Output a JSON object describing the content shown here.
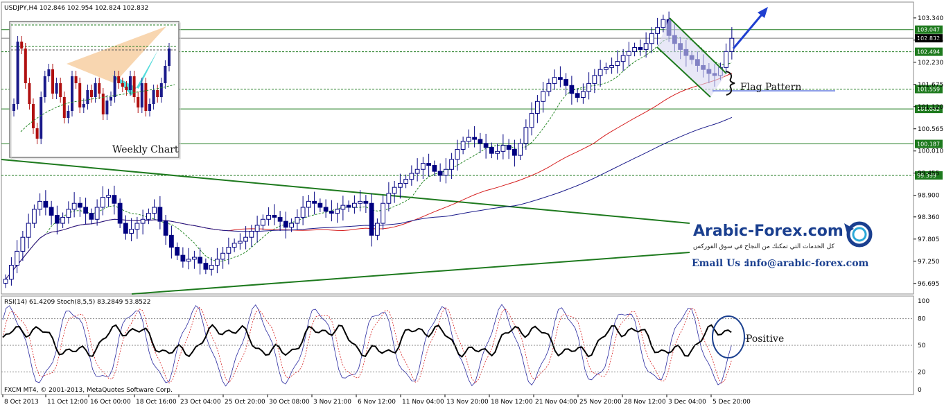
{
  "chart_data": {
    "type": "candlestick",
    "symbol_line": "USDJPY,H4  102.846 102.954 102.824 102.832",
    "y_ticks": [
      "103.340",
      "102.785",
      "102.230",
      "101.675",
      "101.120",
      "100.565",
      "100.010",
      "99.455",
      "98.900",
      "98.360",
      "97.805",
      "97.250",
      "96.695"
    ],
    "y_range": [
      96.5,
      103.65
    ],
    "x_ticks": [
      "8 Oct 2013",
      "11 Oct 12:00",
      "16 Oct 00:00",
      "18 Oct 16:00",
      "23 Oct 04:00",
      "25 Oct 20:00",
      "30 Oct 08:00",
      "3 Nov 21:00",
      "6 Nov 12:00",
      "11 Nov 04:00",
      "13 Nov 20:00",
      "18 Nov 12:00",
      "21 Nov 04:00",
      "25 Nov 20:00",
      "28 Nov 12:00",
      "3 Dec 04:00",
      "5 Dec 20:00"
    ],
    "levels": [
      {
        "value": "103.047",
        "style": "solid",
        "boxed": true
      },
      {
        "value": "102.832",
        "style": "solid",
        "boxed": true,
        "current": true
      },
      {
        "value": "102.494",
        "style": "dashed",
        "boxed": true
      },
      {
        "value": "101.559",
        "style": "dashed",
        "boxed": true
      },
      {
        "value": "101.062",
        "style": "solid",
        "boxed": true
      },
      {
        "value": "100.187",
        "style": "solid",
        "boxed": true
      },
      {
        "value": "99.399",
        "style": "dashed",
        "boxed": true
      }
    ],
    "closes": [
      96.8,
      97.15,
      97.5,
      97.85,
      98.2,
      98.55,
      98.75,
      98.6,
      98.4,
      98.2,
      98.35,
      98.55,
      98.7,
      98.6,
      98.45,
      98.3,
      98.6,
      98.85,
      98.9,
      98.7,
      98.2,
      97.95,
      98.05,
      98.2,
      98.3,
      98.45,
      98.6,
      98.25,
      97.9,
      97.6,
      97.4,
      97.25,
      97.3,
      97.35,
      97.2,
      97.05,
      97.15,
      97.3,
      97.45,
      97.6,
      97.7,
      97.75,
      97.85,
      98.0,
      98.15,
      98.3,
      98.4,
      98.35,
      98.25,
      98.1,
      98.2,
      98.35,
      98.6,
      98.75,
      98.7,
      98.6,
      98.5,
      98.45,
      98.55,
      98.65,
      98.6,
      98.7,
      98.75,
      98.7,
      97.9,
      98.2,
      98.7,
      98.95,
      99.1,
      99.2,
      99.3,
      99.45,
      99.55,
      99.7,
      99.65,
      99.5,
      99.4,
      99.55,
      99.8,
      100.05,
      100.25,
      100.35,
      100.3,
      100.2,
      100.1,
      99.95,
      100.0,
      100.15,
      100.05,
      99.9,
      100.2,
      100.6,
      100.95,
      101.25,
      101.5,
      101.7,
      101.85,
      101.8,
      101.65,
      101.45,
      101.35,
      101.5,
      101.7,
      101.9,
      102.05,
      102.1,
      102.15,
      102.25,
      102.4,
      102.5,
      102.6,
      102.55,
      102.7,
      102.95,
      103.1,
      103.3,
      102.9,
      102.7,
      102.55,
      102.4,
      102.3,
      102.15,
      102.05,
      101.95,
      101.9,
      102.1,
      102.5,
      102.83
    ],
    "rsi_label": "RSI(14) 61.4209",
    "stoch_label": "Stoch(8,5,5) 83.2849 53.8522",
    "osc_ticks": [
      "100",
      "80",
      "50",
      "20",
      "0"
    ],
    "osc_levels": [
      80,
      50,
      20
    ]
  },
  "annotations": {
    "flag_pattern": "Flag Pattern",
    "positive": "Positive",
    "weekly_chart": "Weekly Chart"
  },
  "branding": {
    "name": "Arabic-Forex.com",
    "tagline": "كل الخدمات التي تمكنك من النجاح في سوق الفوركس",
    "email_label": "Email Us :",
    "email": "info@arabic-forex.com"
  },
  "footer": {
    "copyright": "FXCM MT4, © 2001-2013, MetaQuotes Software Corp."
  },
  "colors": {
    "bull": "#000080",
    "bear": "#000080",
    "ma_red": "#d62020",
    "ma_blue": "#1a1a8a",
    "ma_green_dash": "#2a8a2a",
    "trend_green": "#1e7a1e",
    "box_green": "#1e7a1e",
    "arrow_blue": "#1f3fd0"
  }
}
